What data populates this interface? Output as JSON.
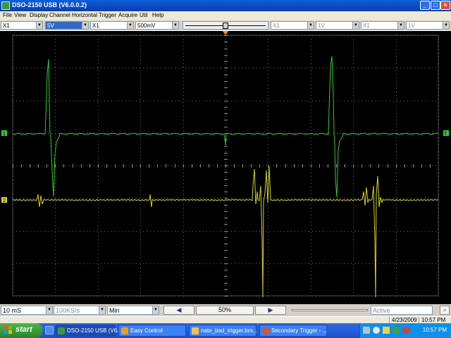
{
  "window": {
    "title": "DSO-2150 USB (V6.0.0.2)"
  },
  "menu": [
    "File",
    "View",
    "Display",
    "Channel",
    "Horizontal",
    "Trigger",
    "Acquire",
    "Util",
    "Help"
  ],
  "channel_bar": {
    "ch1_probe": "X1",
    "ch1_volts": "5V",
    "ch2_probe": "X1",
    "ch2_volts": "500mV",
    "ch3_probe": "X1",
    "ch3_volts": "1V",
    "ch4_probe": "X1",
    "ch4_volts": "1V"
  },
  "bottom_bar": {
    "timebase": "10 mS",
    "sample_rate": "100KS/s",
    "acquire_mode": "Min",
    "zoom": "50%",
    "run_state": "Active"
  },
  "status_bar": {
    "date": "4/23/2009",
    "time": "10:57 PM"
  },
  "taskbar": {
    "start_label": "start",
    "tasks": [
      {
        "label": "DSO-2150 USB (V6.0....",
        "icon_color": "#3a9a3a"
      },
      {
        "label": "Easy Control",
        "icon_color": "#e8a020"
      },
      {
        "label": "nate_bad_trigger.bm...",
        "icon_color": "#f0c050"
      },
      {
        "label": "Secondary Trigger - ...",
        "icon_color": "#e05020"
      }
    ],
    "clock": "10:57 PM"
  },
  "traces": {
    "ch1_color": "#2ecc2e",
    "ch2_color": "#d4d22a",
    "marker_orange": "#ff8c00"
  }
}
